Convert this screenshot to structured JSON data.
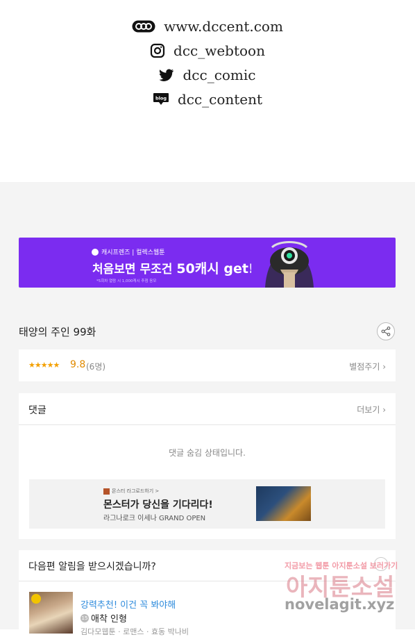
{
  "social": [
    {
      "icon": "dcc-logo-icon",
      "text": "www.dccent.com"
    },
    {
      "icon": "instagram-icon",
      "text": "dcc_webtoon"
    },
    {
      "icon": "twitter-icon",
      "text": "dcc_comic"
    },
    {
      "icon": "blog-icon",
      "text": "dcc_content"
    }
  ],
  "banner": {
    "brand": "캐시프렌즈 | 컬렉스웹툰",
    "headline_pre": "처음보면 무조건 ",
    "headline_big": "50캐시 get!!",
    "fine_print": "*5회차 열람 시 1,000캐시 추첨 응모"
  },
  "episode": {
    "title": "태양의 주인 99화"
  },
  "rating": {
    "stars": "★★★★★",
    "score": "9.8",
    "count": "(6명)",
    "rate_label": "별점주기 ›"
  },
  "comments": {
    "title": "댓글",
    "more": "더보기 ›",
    "hidden_message": "댓글 숨김 상태입니다.",
    "ad": {
      "small": "몬스터 라그로드하기 >",
      "headline": "몬스터가 당신을 기다리다!",
      "sub": "라그나로크 이세나 GRAND OPEN"
    }
  },
  "notify": {
    "title": "다음편 알림을 받으시겠습니까?",
    "recommend": {
      "tag": "강력추천! 이건 꼭 봐야해",
      "age": "15",
      "title": "애착 인형",
      "meta": "김다모웹툰 · 로맨스 · 효동 박나비"
    }
  },
  "watermark": {
    "line1": "지금보는 웹툰 아지툰소설 보러가기",
    "line2": "아지툰소설",
    "line3": "novelagit.xyz"
  },
  "colors": {
    "banner_bg": "#7b2cf0",
    "link_blue": "#2e8bdc",
    "star": "#f3a000"
  }
}
